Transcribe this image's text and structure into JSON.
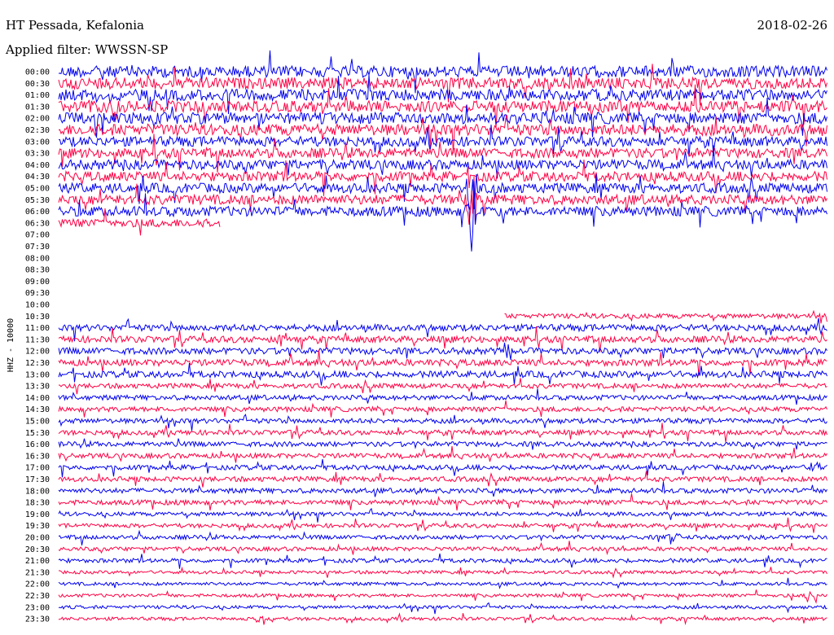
{
  "header": {
    "station": "HT Pessada, Kefalonia",
    "date": "2018-02-26",
    "filter": "Applied filter: WWSSN-SP"
  },
  "channel_label": "HHZ - 10000",
  "colors": {
    "blue": "#0000ee",
    "red": "#ff0044",
    "background": "#ffffff",
    "text": "#000000"
  },
  "chart_data": {
    "type": "line",
    "subtype": "helicorder",
    "ylabel": "HHZ - 10000",
    "row_interval_minutes": 30,
    "row_labels": [
      "00:00",
      "00:30",
      "01:00",
      "01:30",
      "02:00",
      "02:30",
      "03:00",
      "03:30",
      "04:00",
      "04:30",
      "05:00",
      "05:30",
      "06:00",
      "06:30",
      "07:00",
      "07:30",
      "08:00",
      "08:30",
      "09:00",
      "09:30",
      "10:00",
      "10:30",
      "11:00",
      "11:30",
      "12:00",
      "12:30",
      "13:00",
      "13:30",
      "14:00",
      "14:30",
      "15:00",
      "15:30",
      "16:00",
      "16:30",
      "17:00",
      "17:30",
      "18:00",
      "18:30",
      "19:00",
      "19:30",
      "20:00",
      "20:30",
      "21:00",
      "21:30",
      "22:00",
      "22:30",
      "23:00",
      "23:30"
    ],
    "series_colors": [
      "blue",
      "red"
    ],
    "rows": [
      {
        "label": "00:00",
        "start": 0,
        "end": 1,
        "noise": 7
      },
      {
        "label": "00:30",
        "start": 0,
        "end": 1,
        "noise": 7
      },
      {
        "label": "01:00",
        "start": 0,
        "end": 1,
        "noise": 7
      },
      {
        "label": "01:30",
        "start": 0,
        "end": 1,
        "noise": 7
      },
      {
        "label": "02:00",
        "start": 0,
        "end": 1,
        "noise": 7
      },
      {
        "label": "02:30",
        "start": 0,
        "end": 1,
        "noise": 7
      },
      {
        "label": "03:00",
        "start": 0,
        "end": 1,
        "noise": 6
      },
      {
        "label": "03:30",
        "start": 0,
        "end": 1,
        "noise": 6
      },
      {
        "label": "04:00",
        "start": 0,
        "end": 1,
        "noise": 6
      },
      {
        "label": "04:30",
        "start": 0,
        "end": 1,
        "noise": 6
      },
      {
        "label": "05:00",
        "start": 0,
        "end": 1,
        "noise": 6
      },
      {
        "label": "05:30",
        "start": 0,
        "end": 1,
        "noise": 6
      },
      {
        "label": "06:00",
        "start": 0,
        "end": 1,
        "noise": 6
      },
      {
        "label": "06:30",
        "start": 0,
        "end": 0.21,
        "noise": 5
      },
      {
        "label": "07:00",
        "start": 0,
        "end": 0,
        "noise": 0
      },
      {
        "label": "07:30",
        "start": 0,
        "end": 0,
        "noise": 0
      },
      {
        "label": "08:00",
        "start": 0,
        "end": 0,
        "noise": 0
      },
      {
        "label": "08:30",
        "start": 0,
        "end": 0,
        "noise": 0
      },
      {
        "label": "09:00",
        "start": 0,
        "end": 0,
        "noise": 0
      },
      {
        "label": "09:30",
        "start": 0,
        "end": 0,
        "noise": 0
      },
      {
        "label": "10:00",
        "start": 0,
        "end": 0,
        "noise": 0
      },
      {
        "label": "10:30",
        "start": 0.58,
        "end": 1,
        "noise": 3
      },
      {
        "label": "11:00",
        "start": 0,
        "end": 1,
        "noise": 4
      },
      {
        "label": "11:30",
        "start": 0,
        "end": 1,
        "noise": 4
      },
      {
        "label": "12:00",
        "start": 0,
        "end": 1,
        "noise": 4
      },
      {
        "label": "12:30",
        "start": 0,
        "end": 1,
        "noise": 4
      },
      {
        "label": "13:00",
        "start": 0,
        "end": 1,
        "noise": 4
      },
      {
        "label": "13:30",
        "start": 0,
        "end": 1,
        "noise": 3
      },
      {
        "label": "14:00",
        "start": 0,
        "end": 1,
        "noise": 3
      },
      {
        "label": "14:30",
        "start": 0,
        "end": 1,
        "noise": 3
      },
      {
        "label": "15:00",
        "start": 0,
        "end": 1,
        "noise": 3
      },
      {
        "label": "15:30",
        "start": 0,
        "end": 1,
        "noise": 3
      },
      {
        "label": "16:00",
        "start": 0,
        "end": 1,
        "noise": 3
      },
      {
        "label": "16:30",
        "start": 0,
        "end": 1,
        "noise": 3
      },
      {
        "label": "17:00",
        "start": 0,
        "end": 1,
        "noise": 3
      },
      {
        "label": "17:30",
        "start": 0,
        "end": 1,
        "noise": 3
      },
      {
        "label": "18:00",
        "start": 0,
        "end": 1,
        "noise": 3
      },
      {
        "label": "18:30",
        "start": 0,
        "end": 1,
        "noise": 3
      },
      {
        "label": "19:00",
        "start": 0,
        "end": 1,
        "noise": 2.5
      },
      {
        "label": "19:30",
        "start": 0,
        "end": 1,
        "noise": 2.5
      },
      {
        "label": "20:00",
        "start": 0,
        "end": 1,
        "noise": 2.5
      },
      {
        "label": "20:30",
        "start": 0,
        "end": 1,
        "noise": 2.5
      },
      {
        "label": "21:00",
        "start": 0,
        "end": 1,
        "noise": 2.5
      },
      {
        "label": "21:30",
        "start": 0,
        "end": 1,
        "noise": 2
      },
      {
        "label": "22:00",
        "start": 0,
        "end": 1,
        "noise": 2
      },
      {
        "label": "22:30",
        "start": 0,
        "end": 1,
        "noise": 2
      },
      {
        "label": "23:00",
        "start": 0,
        "end": 1,
        "noise": 2
      },
      {
        "label": "23:30",
        "start": 0,
        "end": 1,
        "noise": 2
      }
    ],
    "events": [
      {
        "row": "05:00",
        "pos": 0.537,
        "amp": 55
      },
      {
        "row": "05:30",
        "pos": 0.537,
        "amp": 60
      },
      {
        "row": "06:00",
        "pos": 0.537,
        "amp": 55
      },
      {
        "row": "11:30",
        "pos": 0.29,
        "amp": 10
      },
      {
        "row": "12:00",
        "pos": 0.585,
        "amp": 12
      },
      {
        "row": "17:00",
        "pos": 0.985,
        "amp": 8
      },
      {
        "row": "20:00",
        "pos": 0.8,
        "amp": 14
      },
      {
        "row": "22:30",
        "pos": 0.98,
        "amp": 18
      },
      {
        "row": "23:30",
        "pos": 0.26,
        "amp": 8
      }
    ]
  }
}
